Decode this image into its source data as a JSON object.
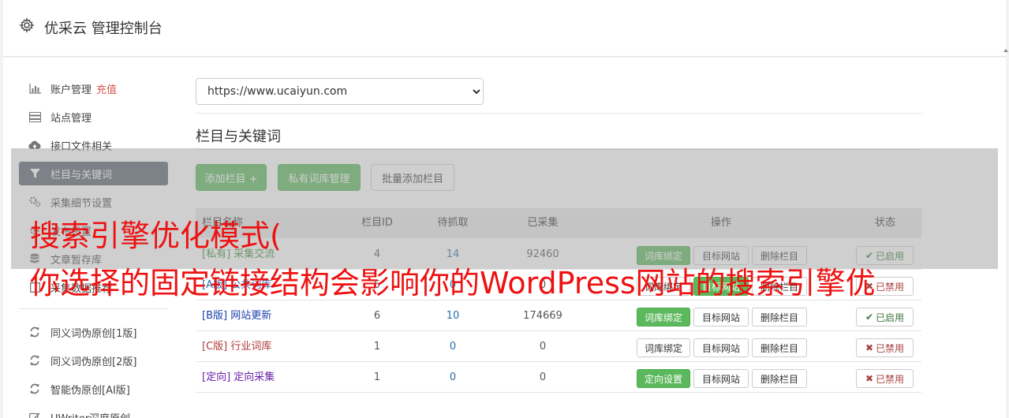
{
  "app": {
    "title": "优采云 管理控制台"
  },
  "sidebar": {
    "items": [
      {
        "icon": "bar-chart-icon",
        "label": "账户管理",
        "extra": "充值"
      },
      {
        "icon": "server-icon",
        "label": "站点管理"
      },
      {
        "icon": "cloud-upload-icon",
        "label": "接口文件相关"
      },
      {
        "icon": "filter-icon",
        "label": "栏目与关键词",
        "active": true
      },
      {
        "icon": "gears-icon",
        "label": "采集细节设置"
      },
      {
        "icon": "settings-icon",
        "label": "发布设置"
      },
      {
        "icon": "database-icon",
        "label": "文章暂存库"
      },
      {
        "icon": "square-icon",
        "label": "采集数据推荐"
      },
      {
        "icon": "refresh-icon",
        "label": "同义词伪原创[1版]"
      },
      {
        "icon": "refresh-icon",
        "label": "同义词伪原创[2版]"
      },
      {
        "icon": "refresh-icon",
        "label": "智能伪原创[AI版]"
      },
      {
        "icon": "edit-icon",
        "label": "UWriter深度原创"
      }
    ]
  },
  "site": {
    "selected": "https://www.ucaiyun.com"
  },
  "section": {
    "title": "栏目与关键词"
  },
  "toolbar": {
    "add_column": "添加栏目 +",
    "private_lib": "私有词库管理",
    "batch_add": "批量添加栏目"
  },
  "table": {
    "headers": {
      "name": "栏目名称",
      "id": "栏目ID",
      "pending": "待抓取",
      "collected": "已采集",
      "actions": "操作",
      "status": "状态"
    },
    "rows": [
      {
        "tag": "[私有]",
        "name": "采集交流",
        "id": "4",
        "pending": "14",
        "collected": "92460",
        "act1": "词库绑定",
        "act2": "目标网站",
        "act3": "删除栏目",
        "status": "已启用"
      },
      {
        "tag": "[A版]",
        "name": "公共词库",
        "id": "5",
        "pending": "0",
        "collected": "0",
        "act1": "词库绑定",
        "act2": "目标网站",
        "act3": "删除栏目",
        "status": "已禁用"
      },
      {
        "tag": "[B版]",
        "name": "网站更新",
        "id": "6",
        "pending": "10",
        "collected": "174669",
        "act1": "词库绑定",
        "act2": "目标网站",
        "act3": "删除栏目",
        "status": "已启用"
      },
      {
        "tag": "[C版]",
        "name": "行业词库",
        "id": "1",
        "pending": "0",
        "collected": "0",
        "act1": "词库绑定",
        "act2": "目标网站",
        "act3": "删除栏目",
        "status": "已禁用"
      },
      {
        "tag": "[定向]",
        "name": "定向采集",
        "id": "1",
        "pending": "0",
        "collected": "0",
        "act1": "定向设置",
        "act2": "目标网站",
        "act3": "删除栏目",
        "status": "已禁用"
      }
    ]
  },
  "watermark": {
    "line1": "搜索引擎优化模式(",
    "line2": "你选择的固定链接结构会影响你的WordPress网站的搜索引擎优"
  },
  "colors": {
    "accent": "#5cb85c",
    "watermark": "#ee1111",
    "active": "#5b6470"
  }
}
